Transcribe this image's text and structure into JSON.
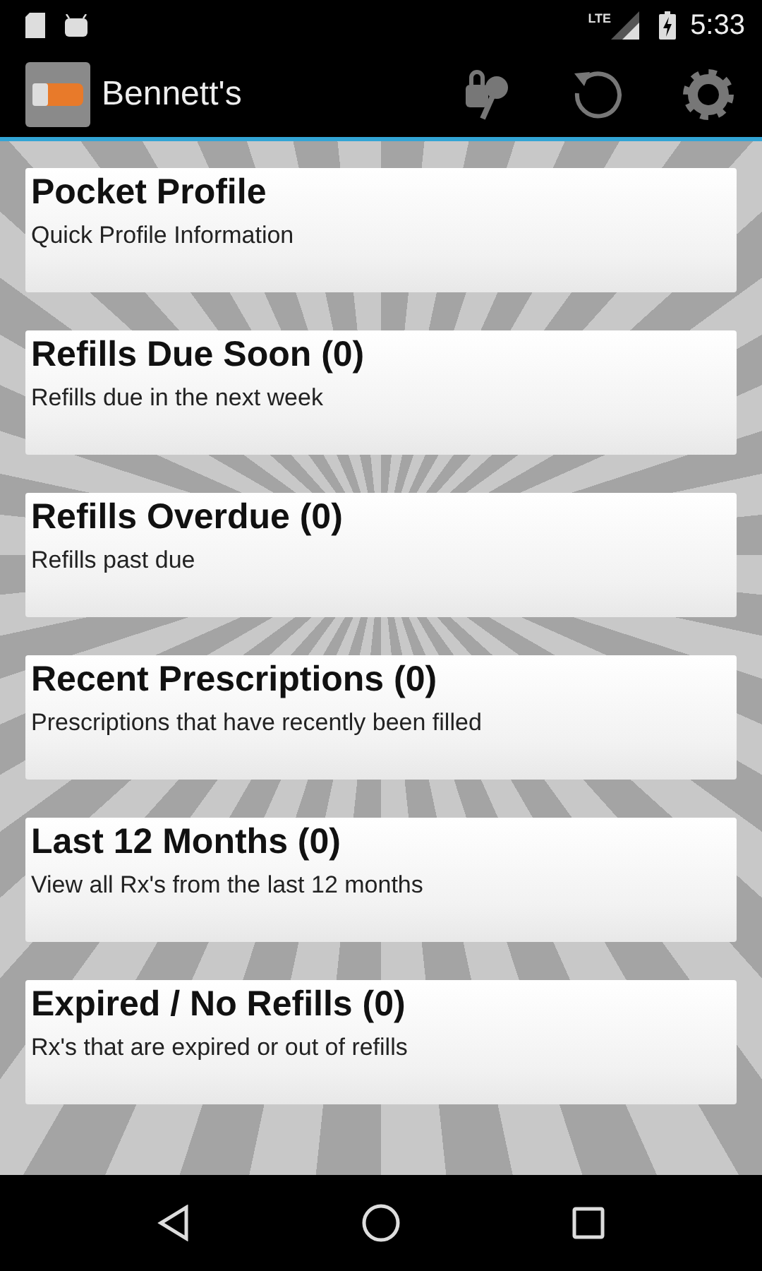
{
  "status_bar": {
    "time": "5:33",
    "network": "LTE"
  },
  "action_bar": {
    "title": "Bennett's"
  },
  "cards": [
    {
      "title": "Pocket Profile",
      "subtitle": "Quick Profile Information"
    },
    {
      "title": "Refills Due Soon (0)",
      "subtitle": "Refills due in the next week"
    },
    {
      "title": "Refills Overdue (0)",
      "subtitle": "Refills past due"
    },
    {
      "title": "Recent Prescriptions (0)",
      "subtitle": "Prescriptions that have recently been filled"
    },
    {
      "title": "Last 12 Months (0)",
      "subtitle": "View all Rx's from the last 12 months"
    },
    {
      "title": "Expired / No Refills (0)",
      "subtitle": "Rx's that are expired or out of refills"
    }
  ]
}
